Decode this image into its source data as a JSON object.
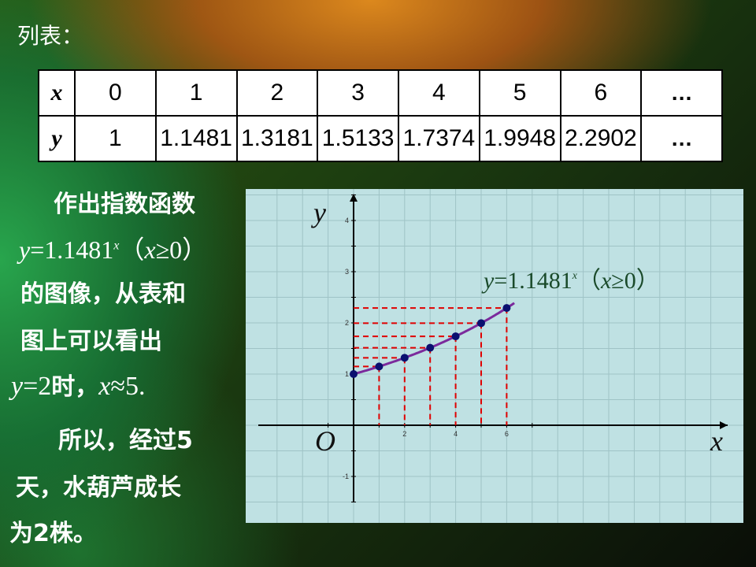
{
  "heading": "列表：",
  "table": {
    "x_label": "x",
    "y_label": "y",
    "x_values": [
      "0",
      "1",
      "2",
      "3",
      "4",
      "5",
      "6"
    ],
    "y_values": [
      "1",
      "1.1481",
      "1.3181",
      "1.5133",
      "1.7374",
      "1.9948",
      "2.2902"
    ],
    "ellipsis": "…"
  },
  "text": {
    "line1": "作出指数函数",
    "formula_y": "y",
    "formula_eq": "=1.1481",
    "formula_exp": "x",
    "formula_cond_open": "（",
    "formula_cond_x": "x",
    "formula_cond_rest": "≥0）",
    "line3": "的图像，从表和",
    "line4": "图上可以看出",
    "line5_y": "y",
    "line5_eq": "=2",
    "line5_mid": "时，",
    "line5_x": "x",
    "line5_rest": "≈5.",
    "line6": "所以，经过5",
    "line7": "天，水葫芦成长",
    "line8": "为2株。"
  },
  "chart_data": {
    "type": "scatter",
    "title": "",
    "xlabel": "x",
    "ylabel": "y",
    "origin_label": "O",
    "xlim": [
      -1.9,
      7.6
    ],
    "ylim": [
      -1.5,
      4.5
    ],
    "x_tick_labels": [
      "2",
      "4",
      "6"
    ],
    "y_tick_labels": [
      "-1",
      "1",
      "2",
      "3",
      "4"
    ],
    "grid": true,
    "series": [
      {
        "x": [
          0,
          1,
          2,
          3,
          4,
          5,
          6
        ],
        "y": [
          1,
          1.1481,
          1.3181,
          1.5133,
          1.7374,
          1.9948,
          2.2902
        ]
      }
    ],
    "curve_label": "y=1.1481^x（x≥0）",
    "curve_color": "#7b2a9c",
    "point_color": "#0a1070",
    "guide_color": "#e00000"
  }
}
